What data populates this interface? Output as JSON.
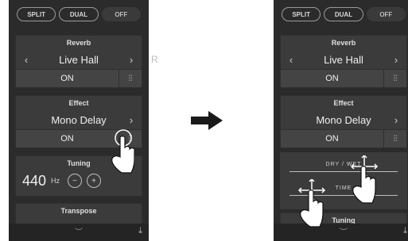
{
  "modes": [
    "SPLIT",
    "DUAL",
    "OFF"
  ],
  "reverb": {
    "title": "Reverb",
    "value": "Live Hall",
    "on": "ON"
  },
  "effect": {
    "title": "Effect",
    "value": "Mono Delay",
    "on": "ON"
  },
  "tuning": {
    "title": "Tuning",
    "value": "440",
    "unit": "Hz"
  },
  "transpose": {
    "title": "Transpose"
  },
  "sliders": {
    "dry_wet": "DRY / WET",
    "time": "TIME"
  },
  "icons": {
    "arrow_left": "‹",
    "arrow_right": "›",
    "mixer": "⫶⫶",
    "minus": "−",
    "plus": "+",
    "chevron": "︶",
    "share": "⤓"
  },
  "partial_letter": "R",
  "colors": {
    "panel": "#2b2b2b",
    "card": "#3b3b3b",
    "hand": "#ffffff",
    "arrow": "#1a1a1a"
  }
}
